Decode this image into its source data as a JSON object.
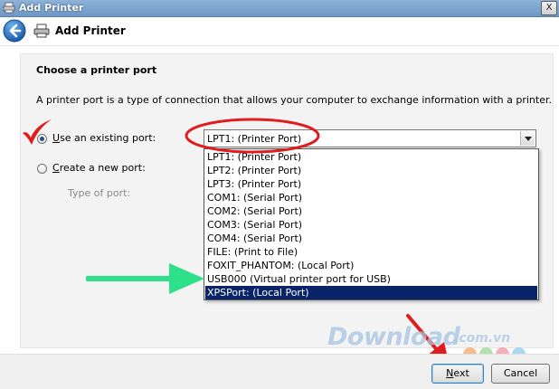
{
  "window": {
    "title": "Add Printer",
    "close_label": "X"
  },
  "header": {
    "title": "Add Printer"
  },
  "content": {
    "heading": "Choose a printer port",
    "description": "A printer port is a type of connection that allows your computer to exchange information with a printer.",
    "existing_port": {
      "label_prefix": "",
      "label_accel": "U",
      "label_rest": "se an existing port:",
      "checked": true
    },
    "new_port": {
      "label_accel": "C",
      "label_rest": "reate a new port:",
      "checked": false
    },
    "type_of_port": {
      "label": "Type of port:"
    },
    "port_select": {
      "value": "LPT1: (Printer Port)",
      "options": [
        "LPT1: (Printer Port)",
        "LPT2: (Printer Port)",
        "LPT3: (Printer Port)",
        "COM1: (Serial Port)",
        "COM2: (Serial Port)",
        "COM3: (Serial Port)",
        "COM4: (Serial Port)",
        "FILE: (Print to File)",
        "FOXIT_PHANTOM: (Local Port)",
        "USB000 (Virtual printer port for USB)",
        "XPSPort: (Local Port)"
      ],
      "highlighted_index": 10
    }
  },
  "watermark": {
    "main": "Download",
    "sub": ".com.vn"
  },
  "footer": {
    "next_accel": "N",
    "next_rest": "ext",
    "cancel_label": "Cancel"
  },
  "colors": {
    "selection": "#0a246a",
    "annotation_red": "#e01c1c",
    "annotation_green": "#2ee08a"
  }
}
